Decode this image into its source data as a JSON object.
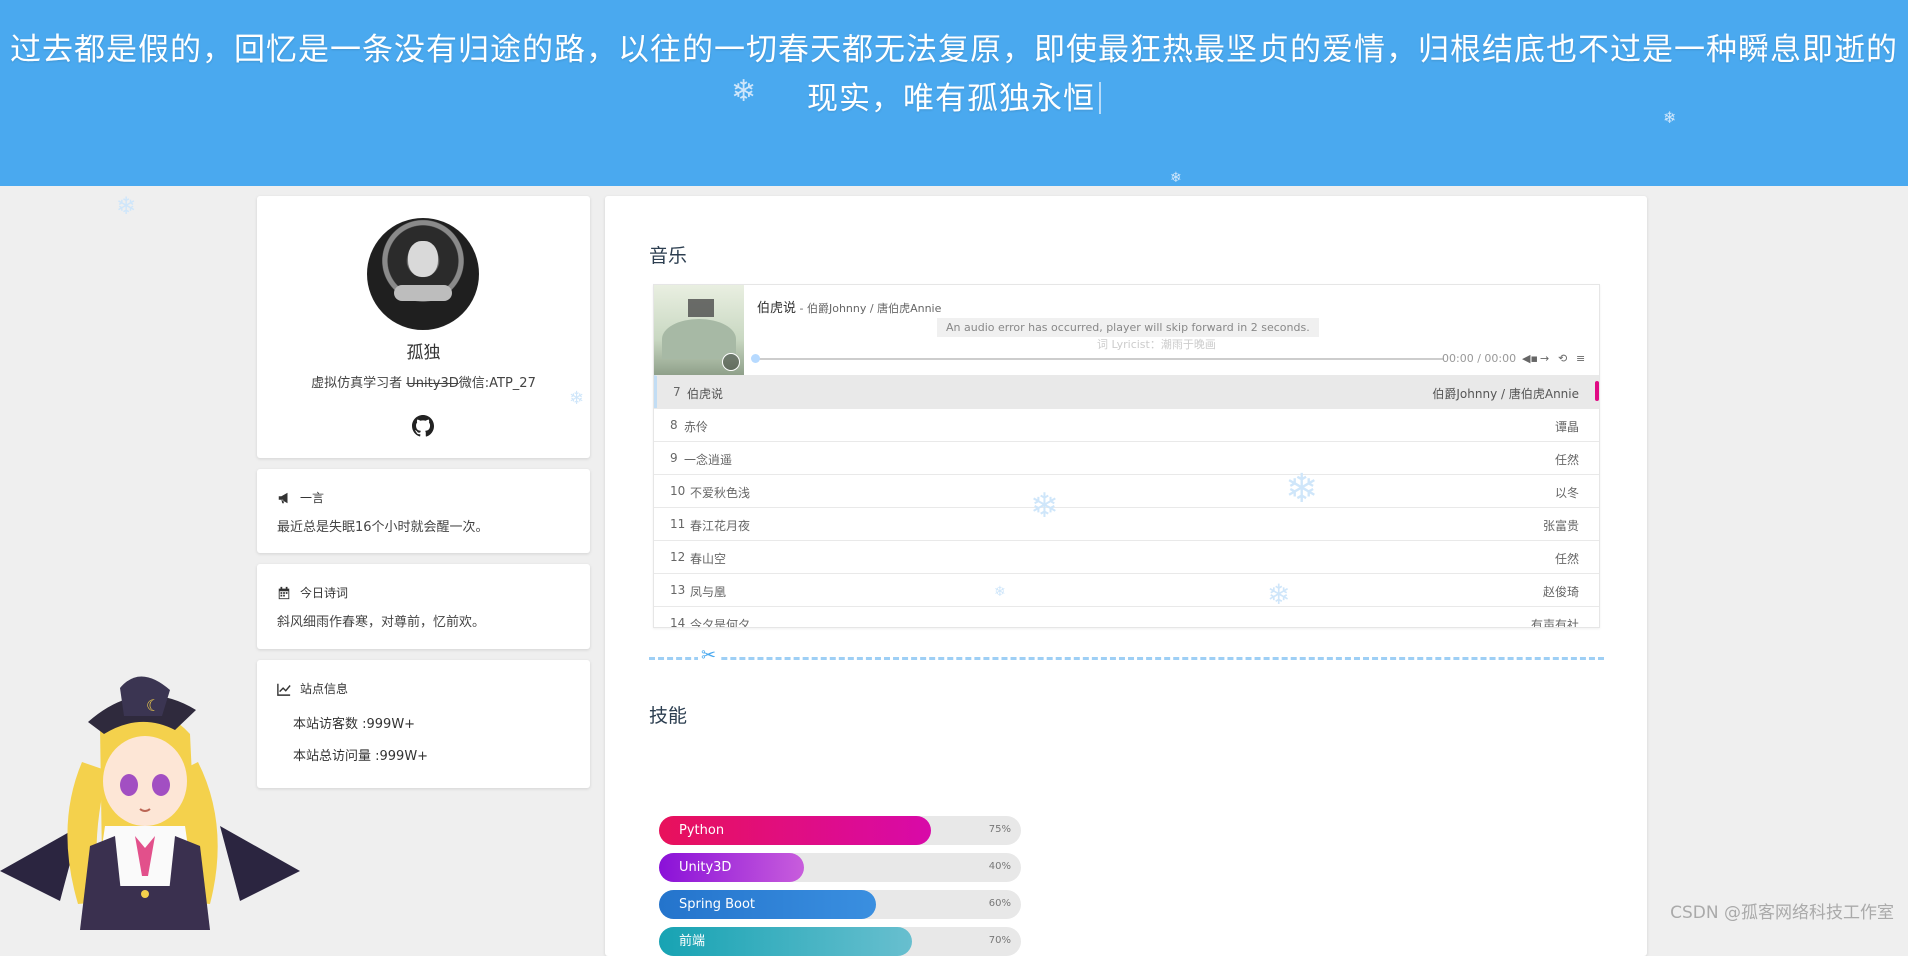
{
  "hero": {
    "quote_line1": "过去都是假的，回忆是一条没有归途的路，以往的一切春天都无法复原，即使最狂热最坚贞的爱情，归根结底也不过是一种瞬息即逝的",
    "quote_line2": "现实，唯有孤独永恒"
  },
  "profile": {
    "name": "孤独",
    "bio_prefix": "虚拟仿真学习者 ",
    "bio_struck": "Unity3D",
    "bio_suffix": "微信:ATP_27",
    "github_icon": "github-icon"
  },
  "oneword": {
    "title": "一言",
    "icon": "bullhorn-icon",
    "text": "最近总是失眠16个小时就会醒一次。"
  },
  "poem": {
    "title": "今日诗词",
    "icon": "calendar-icon",
    "text": "斜风细雨作春寒，对尊前，忆前欢。"
  },
  "stats": {
    "title": "站点信息",
    "icon": "chart-line-icon",
    "visitors": "本站访客数 :999W+",
    "views": "本站总访问量 :999W+"
  },
  "music": {
    "section_title": "音乐",
    "now_playing": {
      "title": "伯虎说",
      "artist": " - 伯爵Johnny / 唐伯虎Annie"
    },
    "error": "An audio error has occurred, player will skip forward in 2 seconds.",
    "lyric": "词 Lyricist：潮雨于晚画",
    "time": "00:00 / 00:00",
    "tracks": [
      {
        "no": "7",
        "title": "伯虎说",
        "artist": "伯爵Johnny / 唐伯虎Annie",
        "active": true
      },
      {
        "no": "8",
        "title": "赤伶",
        "artist": "谭晶"
      },
      {
        "no": "9",
        "title": "一念逍遥",
        "artist": "任然"
      },
      {
        "no": "10",
        "title": "不爱秋色浅",
        "artist": "以冬"
      },
      {
        "no": "11",
        "title": "春江花月夜",
        "artist": "张富贵"
      },
      {
        "no": "12",
        "title": "春山空",
        "artist": "任然"
      },
      {
        "no": "13",
        "title": "凤与凰",
        "artist": "赵俊琦"
      },
      {
        "no": "14",
        "title": "今夕是何夕",
        "artist": "有声有社"
      }
    ]
  },
  "skills": {
    "section_title": "技能",
    "items": [
      {
        "name": "Python",
        "percent": 75,
        "label": "75%",
        "gradient": [
          "#e8115b",
          "#d80aa9"
        ]
      },
      {
        "name": "Unity3D",
        "percent": 40,
        "label": "40%",
        "gradient": [
          "#8a11d8",
          "#c85ddc"
        ]
      },
      {
        "name": "Spring Boot",
        "percent": 60,
        "label": "60%",
        "gradient": [
          "#2474cc",
          "#3a8fe0"
        ]
      },
      {
        "name": "前端",
        "percent": 70,
        "label": "70%",
        "gradient": [
          "#17a3b3",
          "#68bfcf"
        ]
      }
    ]
  },
  "watermark": "CSDN @孤客网络科技工作室"
}
